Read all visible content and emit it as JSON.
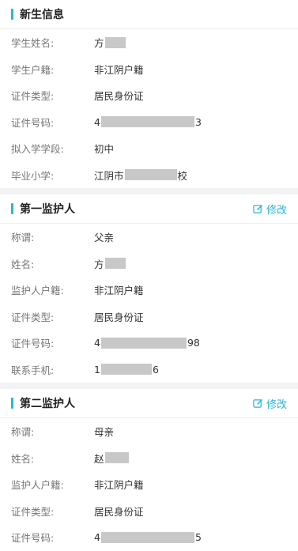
{
  "student": {
    "title": "新生信息",
    "rows": [
      {
        "label": "学生姓名:",
        "prefix": "方",
        "suffix": ""
      },
      {
        "label": "学生户籍:",
        "prefix": "非江阴户籍",
        "suffix": ""
      },
      {
        "label": "证件类型:",
        "prefix": "居民身份证",
        "suffix": ""
      },
      {
        "label": "证件号码:",
        "prefix": "4",
        "suffix": "3"
      },
      {
        "label": "拟入学学段:",
        "prefix": "初中",
        "suffix": ""
      },
      {
        "label": "毕业小学:",
        "prefix": "江阴市",
        "suffix": "校"
      }
    ]
  },
  "guardian1": {
    "title": "第一监护人",
    "edit_label": "修改",
    "rows": [
      {
        "label": "称谓:",
        "prefix": "父亲",
        "suffix": ""
      },
      {
        "label": "姓名:",
        "prefix": "方",
        "suffix": ""
      },
      {
        "label": "监护人户籍:",
        "prefix": "非江阴户籍",
        "suffix": ""
      },
      {
        "label": "证件类型:",
        "prefix": "居民身份证",
        "suffix": ""
      },
      {
        "label": "证件号码:",
        "prefix": "4",
        "suffix": "98"
      },
      {
        "label": "联系手机:",
        "prefix": "1",
        "suffix": "6"
      }
    ]
  },
  "guardian2": {
    "title": "第二监护人",
    "edit_label": "修改",
    "rows": [
      {
        "label": "称谓:",
        "prefix": "母亲",
        "suffix": ""
      },
      {
        "label": "姓名:",
        "prefix": "赵",
        "suffix": ""
      },
      {
        "label": "监护人户籍:",
        "prefix": "非江阴户籍",
        "suffix": ""
      },
      {
        "label": "证件类型:",
        "prefix": "居民身份证",
        "suffix": ""
      },
      {
        "label": "证件号码:",
        "prefix": "4",
        "suffix": "5"
      }
    ]
  },
  "colors": {
    "accent": "#29b6d9",
    "mask": "#c8c8c8"
  }
}
